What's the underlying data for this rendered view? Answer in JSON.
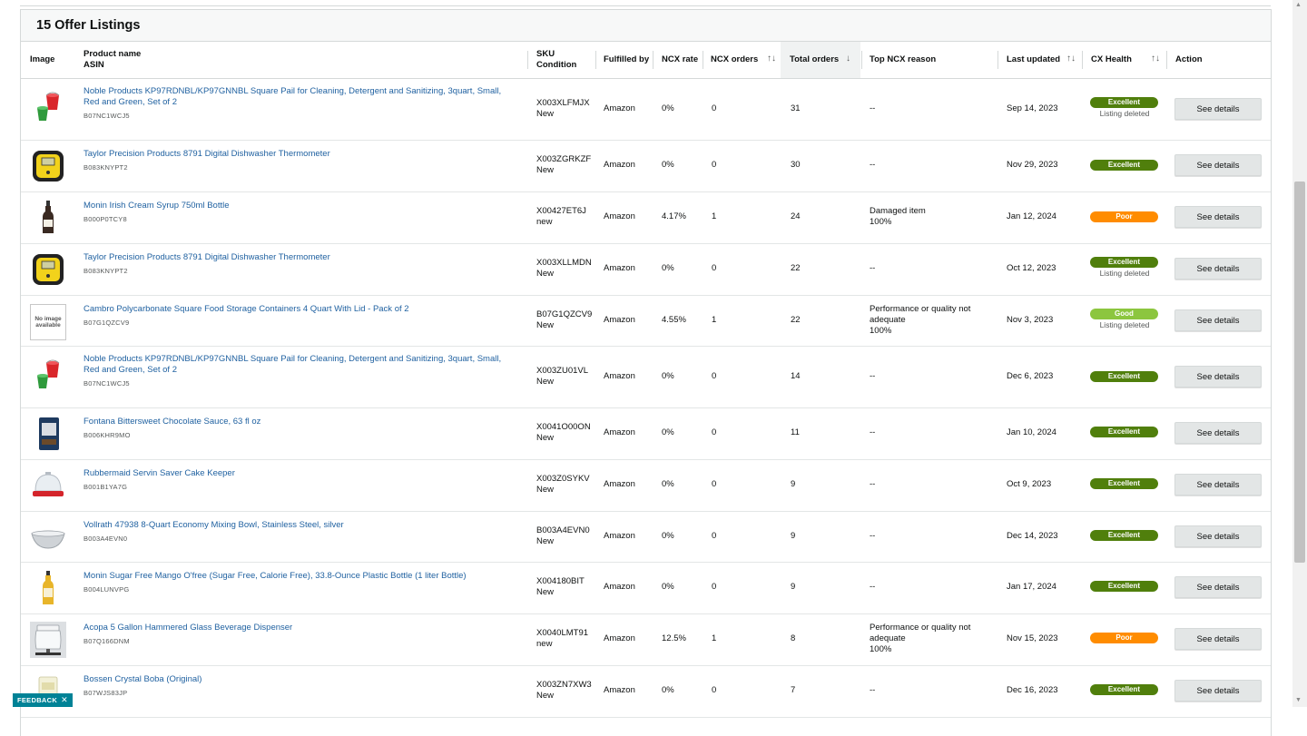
{
  "panel": {
    "title": "15 Offer Listings"
  },
  "columns": {
    "image": "Image",
    "product_name": "Product name",
    "asin": "ASIN",
    "sku": "SKU",
    "condition": "Condition",
    "fulfilled_by": "Fulfilled by",
    "ncx_rate": "NCX rate",
    "ncx_orders": "NCX orders",
    "total_orders": "Total orders",
    "top_ncx_reason": "Top NCX reason",
    "last_updated": "Last updated",
    "cx_health": "CX Health",
    "action": "Action"
  },
  "sort_icons": {
    "both": "↑↓",
    "down": "↓"
  },
  "rows": [
    {
      "name": "Noble Products KP97RDNBL/KP97GNNBL Square Pail for Cleaning, Detergent and Sanitizing, 3quart, Small, Red and Green, Set of 2",
      "asin": "B07NC1WCJ5",
      "sku": "X003XLFMJX",
      "condition": "New",
      "fulfilled_by": "Amazon",
      "ncx_rate": "0%",
      "ncx_orders": "0",
      "total_orders": "31",
      "reason": "--",
      "reason_pct": "",
      "last_updated": "Sep 14, 2023",
      "health": "Excellent",
      "health_note": "Listing deleted",
      "action": "See details"
    },
    {
      "name": "Taylor Precision Products 8791 Digital Dishwasher Thermometer",
      "asin": "B083KNYPT2",
      "sku": "X003ZGRKZF",
      "condition": "New",
      "fulfilled_by": "Amazon",
      "ncx_rate": "0%",
      "ncx_orders": "0",
      "total_orders": "30",
      "reason": "--",
      "reason_pct": "",
      "last_updated": "Nov 29, 2023",
      "health": "Excellent",
      "health_note": "",
      "action": "See details"
    },
    {
      "name": "Monin Irish Cream Syrup 750ml Bottle",
      "asin": "B000P0TCY8",
      "sku": "X00427ET6J",
      "condition": "new",
      "fulfilled_by": "Amazon",
      "ncx_rate": "4.17%",
      "ncx_orders": "1",
      "total_orders": "24",
      "reason": "Damaged item",
      "reason_pct": "100%",
      "last_updated": "Jan 12, 2024",
      "health": "Poor",
      "health_note": "",
      "action": "See details"
    },
    {
      "name": "Taylor Precision Products 8791 Digital Dishwasher Thermometer",
      "asin": "B083KNYPT2",
      "sku": "X003XLLMDN",
      "condition": "New",
      "fulfilled_by": "Amazon",
      "ncx_rate": "0%",
      "ncx_orders": "0",
      "total_orders": "22",
      "reason": "--",
      "reason_pct": "",
      "last_updated": "Oct 12, 2023",
      "health": "Excellent",
      "health_note": "Listing deleted",
      "action": "See details"
    },
    {
      "name": "Cambro Polycarbonate Square Food Storage Containers 4 Quart With Lid - Pack of 2",
      "asin": "B07G1QZCV9",
      "sku": "B07G1QZCV9",
      "condition": "New",
      "fulfilled_by": "Amazon",
      "ncx_rate": "4.55%",
      "ncx_orders": "1",
      "total_orders": "22",
      "reason": "Performance or quality not adequate",
      "reason_pct": "100%",
      "last_updated": "Nov 3, 2023",
      "health": "Good",
      "health_note": "Listing deleted",
      "action": "See details",
      "no_image": "No image available"
    },
    {
      "name": "Noble Products KP97RDNBL/KP97GNNBL Square Pail for Cleaning, Detergent and Sanitizing, 3quart, Small, Red and Green, Set of 2",
      "asin": "B07NC1WCJ5",
      "sku": "X003ZU01VL",
      "condition": "New",
      "fulfilled_by": "Amazon",
      "ncx_rate": "0%",
      "ncx_orders": "0",
      "total_orders": "14",
      "reason": "--",
      "reason_pct": "",
      "last_updated": "Dec 6, 2023",
      "health": "Excellent",
      "health_note": "",
      "action": "See details"
    },
    {
      "name": "Fontana Bittersweet Chocolate Sauce, 63 fl oz",
      "asin": "B006KHR9MO",
      "sku": "X0041O00ON",
      "condition": "New",
      "fulfilled_by": "Amazon",
      "ncx_rate": "0%",
      "ncx_orders": "0",
      "total_orders": "11",
      "reason": "--",
      "reason_pct": "",
      "last_updated": "Jan 10, 2024",
      "health": "Excellent",
      "health_note": "",
      "action": "See details"
    },
    {
      "name": "Rubbermaid Servin Saver Cake Keeper",
      "asin": "B001B1YA7G",
      "sku": "X003Z0SYKV",
      "condition": "New",
      "fulfilled_by": "Amazon",
      "ncx_rate": "0%",
      "ncx_orders": "0",
      "total_orders": "9",
      "reason": "--",
      "reason_pct": "",
      "last_updated": "Oct 9, 2023",
      "health": "Excellent",
      "health_note": "",
      "action": "See details"
    },
    {
      "name": "Vollrath 47938 8-Quart Economy Mixing Bowl, Stainless Steel, silver",
      "asin": "B003A4EVN0",
      "sku": "B003A4EVN0",
      "condition": "New",
      "fulfilled_by": "Amazon",
      "ncx_rate": "0%",
      "ncx_orders": "0",
      "total_orders": "9",
      "reason": "--",
      "reason_pct": "",
      "last_updated": "Dec 14, 2023",
      "health": "Excellent",
      "health_note": "",
      "action": "See details"
    },
    {
      "name": "Monin Sugar Free Mango O'free (Sugar Free, Calorie Free), 33.8-Ounce Plastic Bottle (1 liter Bottle)",
      "asin": "B004LUNVPG",
      "sku": "X004180BIT",
      "condition": "New",
      "fulfilled_by": "Amazon",
      "ncx_rate": "0%",
      "ncx_orders": "0",
      "total_orders": "9",
      "reason": "--",
      "reason_pct": "",
      "last_updated": "Jan 17, 2024",
      "health": "Excellent",
      "health_note": "",
      "action": "See details"
    },
    {
      "name": "Acopa 5 Gallon Hammered Glass Beverage Dispenser",
      "asin": "B07Q166DNM",
      "sku": "X0040LMT91",
      "condition": "new",
      "fulfilled_by": "Amazon",
      "ncx_rate": "12.5%",
      "ncx_orders": "1",
      "total_orders": "8",
      "reason": "Performance or quality not adequate",
      "reason_pct": "100%",
      "last_updated": "Nov 15, 2023",
      "health": "Poor",
      "health_note": "",
      "action": "See details"
    },
    {
      "name": "Bossen Crystal Boba (Original)",
      "asin": "B07WJS83JP",
      "sku": "X003ZN7XW3",
      "condition": "New",
      "fulfilled_by": "Amazon",
      "ncx_rate": "0%",
      "ncx_orders": "0",
      "total_orders": "7",
      "reason": "--",
      "reason_pct": "",
      "last_updated": "Dec 16, 2023",
      "health": "Excellent",
      "health_note": "",
      "action": "See details"
    }
  ],
  "feedback": {
    "label": "FEEDBACK",
    "close": "✕"
  }
}
